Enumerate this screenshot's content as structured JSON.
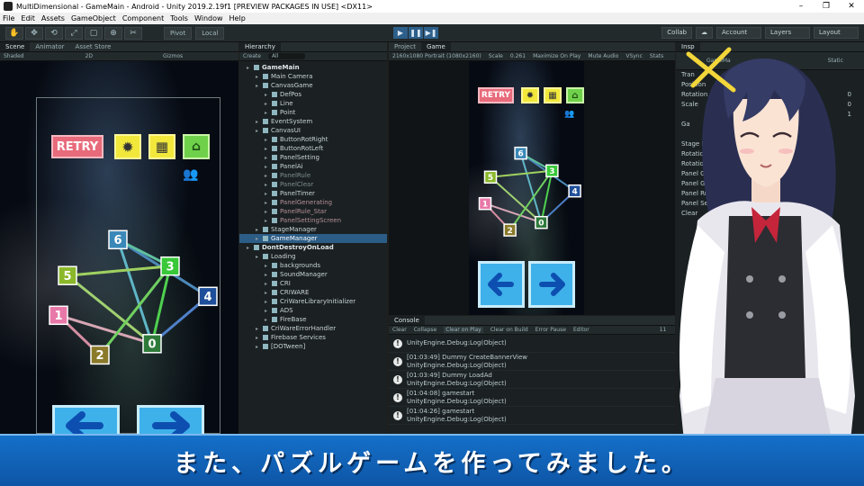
{
  "window": {
    "title": "MultiDimensional - GameMain - Android - Unity 2019.2.19f1 [PREVIEW PACKAGES IN USE] <DX11>",
    "controls": [
      "–",
      "❐",
      "✕"
    ]
  },
  "menu": [
    "File",
    "Edit",
    "Assets",
    "GameObject",
    "Component",
    "Tools",
    "Window",
    "Help"
  ],
  "toolbar": {
    "pivot": "Pivot",
    "local": "Local",
    "collab": "Collab",
    "account": "Account",
    "layers": "Layers",
    "layout": "Layout"
  },
  "scene_panel": {
    "tabs": [
      "Scene",
      "Animator",
      "Asset Store"
    ],
    "shading": "Shaded",
    "mode": "2D",
    "gizmos": "Gizmos"
  },
  "hierarchy": {
    "tab": "Hierarchy",
    "create": "Create",
    "search_placeholder": "All",
    "items": [
      {
        "label": "GameMain",
        "depth": 0,
        "kind": "scene"
      },
      {
        "label": "Main Camera",
        "depth": 1
      },
      {
        "label": "CanvasGame",
        "depth": 1
      },
      {
        "label": "DefPos",
        "depth": 2
      },
      {
        "label": "Line",
        "depth": 2
      },
      {
        "label": "Point",
        "depth": 2
      },
      {
        "label": "EventSystem",
        "depth": 1
      },
      {
        "label": "CanvasUI",
        "depth": 1
      },
      {
        "label": "ButtonRotRight",
        "depth": 2
      },
      {
        "label": "ButtonRotLeft",
        "depth": 2
      },
      {
        "label": "PanelSetting",
        "depth": 2
      },
      {
        "label": "PanelAi",
        "depth": 2
      },
      {
        "label": "PanelRule",
        "depth": 2,
        "kind": "dim"
      },
      {
        "label": "PanelClear",
        "depth": 2,
        "kind": "dim"
      },
      {
        "label": "PanelTimer",
        "depth": 2
      },
      {
        "label": "PanelGenerating",
        "depth": 2,
        "kind": "pink"
      },
      {
        "label": "PanelRule_Star",
        "depth": 2,
        "kind": "pink"
      },
      {
        "label": "PanelSettingScreen",
        "depth": 2,
        "kind": "pink"
      },
      {
        "label": "StageManager",
        "depth": 1
      },
      {
        "label": "GameManager",
        "depth": 1,
        "kind": "sel"
      },
      {
        "label": "DontDestroyOnLoad",
        "depth": 0,
        "kind": "scene"
      },
      {
        "label": "Loading",
        "depth": 1
      },
      {
        "label": "backgrounds",
        "depth": 2
      },
      {
        "label": "SoundManager",
        "depth": 2
      },
      {
        "label": "CRI",
        "depth": 2
      },
      {
        "label": "CRIWARE",
        "depth": 2
      },
      {
        "label": "CriWareLibraryInitializer",
        "depth": 2
      },
      {
        "label": "ADS",
        "depth": 2
      },
      {
        "label": "FireBase",
        "depth": 2
      },
      {
        "label": "CriWareErrorHandler",
        "depth": 1
      },
      {
        "label": "Firebase Services",
        "depth": 1
      },
      {
        "label": "[DOTween]",
        "depth": 1
      }
    ]
  },
  "game_panel": {
    "tabs": [
      "Project",
      "Game"
    ],
    "resolution": "2160x1080 Portrait (1080x2160)",
    "scale_label": "Scale",
    "scale_value": "0.261",
    "options": [
      "Maximize On Play",
      "Mute Audio",
      "VSync",
      "Stats"
    ]
  },
  "game": {
    "retry_label": "RETRY",
    "nodes": [
      {
        "label": "0",
        "color": "#2f7a3a",
        "fx": 0.62,
        "fy": 0.78
      },
      {
        "label": "1",
        "color": "#e878a8",
        "fx": 0.1,
        "fy": 0.63
      },
      {
        "label": "2",
        "color": "#8a7a2a",
        "fx": 0.33,
        "fy": 0.84
      },
      {
        "label": "3",
        "color": "#38c838",
        "fx": 0.72,
        "fy": 0.37
      },
      {
        "label": "4",
        "color": "#1f4f9a",
        "fx": 0.93,
        "fy": 0.53
      },
      {
        "label": "5",
        "color": "#8ab82a",
        "fx": 0.15,
        "fy": 0.42
      },
      {
        "label": "6",
        "color": "#3a88b8",
        "fx": 0.43,
        "fy": 0.23
      }
    ],
    "edges": [
      {
        "a": 0,
        "b": 1,
        "color": "#d7a7b5"
      },
      {
        "a": 0,
        "b": 5,
        "color": "#a0d070"
      },
      {
        "a": 0,
        "b": 6,
        "color": "#5fb6c6"
      },
      {
        "a": 0,
        "b": 3,
        "color": "#4fd04f"
      },
      {
        "a": 0,
        "b": 4,
        "color": "#4f7fc8"
      },
      {
        "a": 2,
        "b": 3,
        "color": "#70d060"
      },
      {
        "a": 2,
        "b": 1,
        "color": "#d58ea2"
      },
      {
        "a": 6,
        "b": 4,
        "color": "#4a88b8"
      },
      {
        "a": 5,
        "b": 3,
        "color": "#9fd060"
      },
      {
        "a": 6,
        "b": 3,
        "color": "#60c0a0"
      }
    ]
  },
  "console": {
    "tab": "Console",
    "buttons": [
      "Clear",
      "Collapse",
      "Clear on Play",
      "Clear on Build",
      "Error Pause",
      "Editor"
    ],
    "count": "11",
    "entries": [
      {
        "line1": "",
        "line2": "UnityEngine.Debug:Log(Object)"
      },
      {
        "line1": "[01:03:49] Dummy CreateBannerView",
        "line2": "UnityEngine.Debug:Log(Object)"
      },
      {
        "line1": "[01:03:49] Dummy LoadAd",
        "line2": "UnityEngine.Debug:Log(Object)"
      },
      {
        "line1": "[01:04:08] gamestart",
        "line2": "UnityEngine.Debug:Log(Object)"
      },
      {
        "line1": "[01:04:26] gamestart",
        "line2": "UnityEngine.Debug:Log(Object)"
      }
    ]
  },
  "inspector": {
    "tab": "Insp",
    "object_name": "GameMa",
    "static_label": "Static",
    "rows": [
      "Tran",
      "Position",
      "Rotation",
      "Scale",
      "",
      "Ga",
      "",
      "Stage Ma",
      "Rotation B",
      "Rotation B",
      "Panel Gam",
      "Panel Game Scr",
      "Panel Rul",
      "Panel Se",
      "Clear"
    ],
    "values": [
      "0",
      "0",
      "1"
    ]
  },
  "subtitle": "また、パズルゲームを作ってみました。",
  "colors": {
    "accent": "#2c5d86",
    "subtitle_bg": "#1470c8"
  }
}
